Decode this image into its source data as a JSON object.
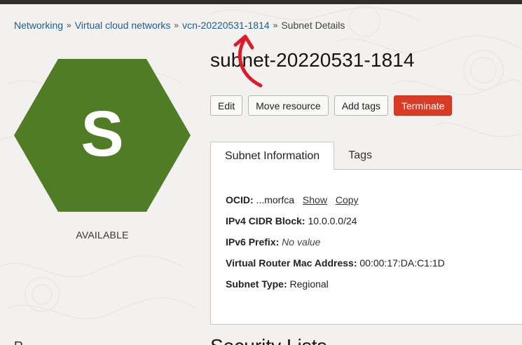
{
  "breadcrumb": {
    "items": [
      {
        "label": "Networking"
      },
      {
        "label": "Virtual cloud networks"
      },
      {
        "label": "vcn-20220531-1814"
      }
    ],
    "current": "Subnet Details"
  },
  "resource": {
    "icon_letter": "S",
    "status": "AVAILABLE",
    "icon_color": "#507c26"
  },
  "page_title": "subnet-20220531-1814",
  "actions": {
    "edit": "Edit",
    "move": "Move resource",
    "add_tags": "Add tags",
    "terminate": "Terminate"
  },
  "tabs": [
    {
      "label": "Subnet Information",
      "active": true
    },
    {
      "label": "Tags",
      "active": false
    }
  ],
  "info": {
    "ocid": {
      "label": "OCID:",
      "value": "...morfca",
      "show": "Show",
      "copy": "Copy"
    },
    "ipv4": {
      "label": "IPv4 CIDR Block:",
      "value": "10.0.0.0/24"
    },
    "ipv6": {
      "label": "IPv6 Prefix:",
      "value": "No value"
    },
    "vrmac": {
      "label": "Virtual Router Mac Address:",
      "value": "00:00:17:DA:C1:1D"
    },
    "type": {
      "label": "Subnet Type:",
      "value": "Regional"
    }
  },
  "bottom_section_title": "Security Lists",
  "bottom_left_text": "R",
  "colors": {
    "link": "#1f5d88",
    "danger": "#d73a25",
    "annotation_arrow": "#e0192a"
  }
}
